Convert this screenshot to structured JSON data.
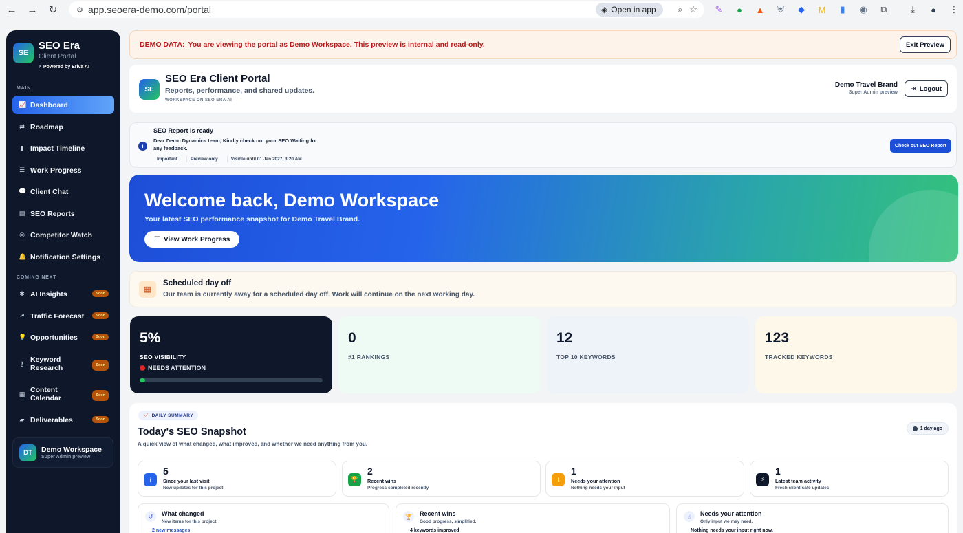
{
  "browser": {
    "url": "app.seoera-demo.com/portal",
    "open_in_app": "Open in app"
  },
  "sidebar": {
    "brand_name": "SEO Era",
    "brand_sub": "Client Portal",
    "brand_initials": "SE",
    "powered_by": "Powered by Eriva AI",
    "main_label": "MAIN",
    "main_items": [
      {
        "label": "Dashboard",
        "icon": "chart-line-icon",
        "active": true
      },
      {
        "label": "Roadmap",
        "icon": "route-icon"
      },
      {
        "label": "Impact Timeline",
        "icon": "bar-chart-icon"
      },
      {
        "label": "Work Progress",
        "icon": "list-check-icon"
      },
      {
        "label": "Client Chat",
        "icon": "chat-icon"
      },
      {
        "label": "SEO Reports",
        "icon": "document-icon"
      },
      {
        "label": "Competitor Watch",
        "icon": "radar-icon"
      },
      {
        "label": "Notification Settings",
        "icon": "bell-icon"
      }
    ],
    "coming_label": "COMING NEXT",
    "coming_items": [
      {
        "label": "AI Insights",
        "icon": "brain-icon",
        "badge": "Soon"
      },
      {
        "label": "Traffic Forecast",
        "icon": "trend-icon",
        "badge": "Soon"
      },
      {
        "label": "Opportunities",
        "icon": "lightbulb-icon",
        "badge": "Soon"
      },
      {
        "label": "Keyword Research",
        "icon": "key-icon",
        "badge": "Soon"
      },
      {
        "label": "Content Calendar",
        "icon": "calendar-icon",
        "badge": "Soon"
      },
      {
        "label": "Deliverables",
        "icon": "folder-icon",
        "badge": "Soon"
      }
    ],
    "workspace": {
      "initials": "DT",
      "name": "Demo Workspace",
      "role": "Super Admin preview"
    }
  },
  "demo_banner": {
    "prefix": "DEMO DATA:",
    "text": "You are viewing the portal as Demo Workspace. This preview is internal and read-only.",
    "exit_label": "Exit Preview"
  },
  "header": {
    "logo_initials": "SE",
    "title": "SEO Era Client Portal",
    "subtitle": "Reports, performance, and shared updates.",
    "workspace_line": "WORKSPACE ON SEO ERA AI",
    "brand": "Demo Travel Brand",
    "role": "Super Admin preview",
    "logout_label": "Logout"
  },
  "report_notice": {
    "title": "SEO Report is ready",
    "message": "Dear Demo Dynamics team, Kindly check out your SEO Waiting for any feedback.",
    "tags": [
      "Important",
      "Preview only",
      "Visible until 01 Jan 2027, 3:20 AM"
    ],
    "button_label": "Check out SEO Report"
  },
  "hero": {
    "title": "Welcome back, Demo Workspace",
    "subtitle": "Your latest SEO performance snapshot for Demo Travel Brand.",
    "button_label": "View Work Progress"
  },
  "day_off": {
    "title": "Scheduled day off",
    "text": "Our team is currently away for a scheduled day off. Work will continue on the next working day."
  },
  "stats": [
    {
      "value": "5%",
      "label": "SEO VISIBILITY",
      "status": "NEEDS ATTENTION",
      "progress_pct": 3
    },
    {
      "value": "0",
      "label": "#1 RANKINGS"
    },
    {
      "value": "12",
      "label": "TOP 10 KEYWORDS"
    },
    {
      "value": "123",
      "label": "TRACKED KEYWORDS"
    }
  ],
  "summary": {
    "chip": "DAILY SUMMARY",
    "title": "Today's SEO Snapshot",
    "subtitle": "A quick view of what changed, what improved, and whether we need anything from you.",
    "ago": "1 day ago",
    "minis": [
      {
        "num": "5",
        "t1": "Since your last visit",
        "t2": "New updates for this project",
        "color": "#2563eb",
        "icon": "info-icon"
      },
      {
        "num": "2",
        "t1": "Recent wins",
        "t2": "Progress completed recently",
        "color": "#16a34a",
        "icon": "trophy-icon"
      },
      {
        "num": "1",
        "t1": "Needs your attention",
        "t2": "Nothing needs your input",
        "color": "#f59e0b",
        "icon": "alert-icon"
      },
      {
        "num": "1",
        "t1": "Latest team activity",
        "t2": "Fresh client-safe updates",
        "color": "#0f172a",
        "icon": "bolt-icon"
      }
    ],
    "cards": [
      {
        "t1": "What changed",
        "t2": "New items for this project.",
        "t3": "2 new messages"
      },
      {
        "t1": "Recent wins",
        "t2": "Good progress, simplified.",
        "t3": "4 keywords improved"
      },
      {
        "t1": "Needs your attention",
        "t2": "Only input we may need.",
        "t3": "Nothing needs your input right now."
      }
    ]
  }
}
